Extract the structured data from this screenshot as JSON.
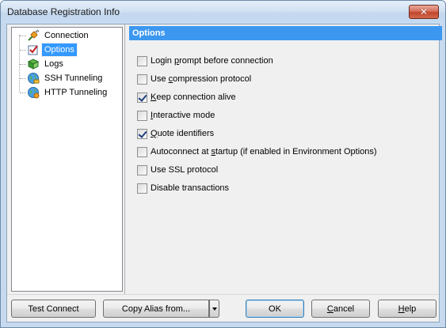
{
  "window": {
    "title": "Database Registration Info",
    "close_glyph": "✕"
  },
  "tree": {
    "items": [
      {
        "label": "Connection",
        "icon": "plug-icon"
      },
      {
        "label": "Options",
        "icon": "checkbox-list-icon",
        "selected": true
      },
      {
        "label": "Logs",
        "icon": "book-icon"
      },
      {
        "label": "SSH Tunneling",
        "icon": "globe-key-icon"
      },
      {
        "label": "HTTP Tunneling",
        "icon": "globe-gear-icon"
      }
    ]
  },
  "options": {
    "header": "Options",
    "checkboxes": [
      {
        "pre": "Login ",
        "u": "p",
        "post": "rompt before connection",
        "checked": false
      },
      {
        "pre": "Use ",
        "u": "c",
        "post": "ompression protocol",
        "checked": false
      },
      {
        "pre": "",
        "u": "K",
        "post": "eep connection alive",
        "checked": true
      },
      {
        "pre": "",
        "u": "I",
        "post": "nteractive mode",
        "checked": false
      },
      {
        "pre": "",
        "u": "Q",
        "post": "uote identifiers",
        "checked": true
      },
      {
        "pre": "Autoconnect at ",
        "u": "s",
        "post": "tartup (if enabled in Environment Options)",
        "checked": false
      },
      {
        "pre": "Use SSL protocol",
        "u": "",
        "post": "",
        "checked": false
      },
      {
        "pre": "Disable transactions",
        "u": "",
        "post": "",
        "checked": false
      }
    ]
  },
  "buttons": {
    "test_connect": "Test Connect",
    "copy_alias": "Copy Alias from...",
    "ok": "OK",
    "cancel_pre": "",
    "cancel_u": "C",
    "cancel_post": "ancel",
    "help_pre": "",
    "help_u": "H",
    "help_post": "elp"
  }
}
